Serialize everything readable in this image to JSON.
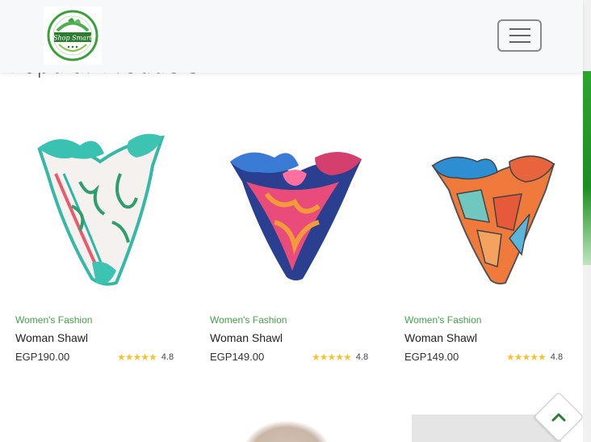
{
  "navbar": {
    "logo_text": "Shop Smart",
    "logo_icon": "shop-smart-logo",
    "menu_icon": "hamburger-icon"
  },
  "section": {
    "title": "Popular Products"
  },
  "products": [
    {
      "category": "Women's Fashion",
      "name": "Woman Shawl",
      "price": "EGP190.00",
      "stars": "★★★★★",
      "rating": "4.8",
      "image_icon": "scarf-image-white-floral"
    },
    {
      "category": "Women's Fashion",
      "name": "Woman Shawl",
      "price": "EGP149.00",
      "stars": "★★★★★",
      "rating": "4.8",
      "image_icon": "scarf-image-pink-navy"
    },
    {
      "category": "Women's Fashion",
      "name": "Woman Shawl",
      "price": "EGP149.00",
      "stars": "★★★★★",
      "rating": "4.8",
      "image_icon": "scarf-image-orange-mosaic"
    }
  ],
  "colors": {
    "accent_green": "#43a047",
    "star_yellow": "#f4c430",
    "navbar_bg": "#f7f8f9"
  },
  "back_to_top_icon": "chevron-up-icon"
}
